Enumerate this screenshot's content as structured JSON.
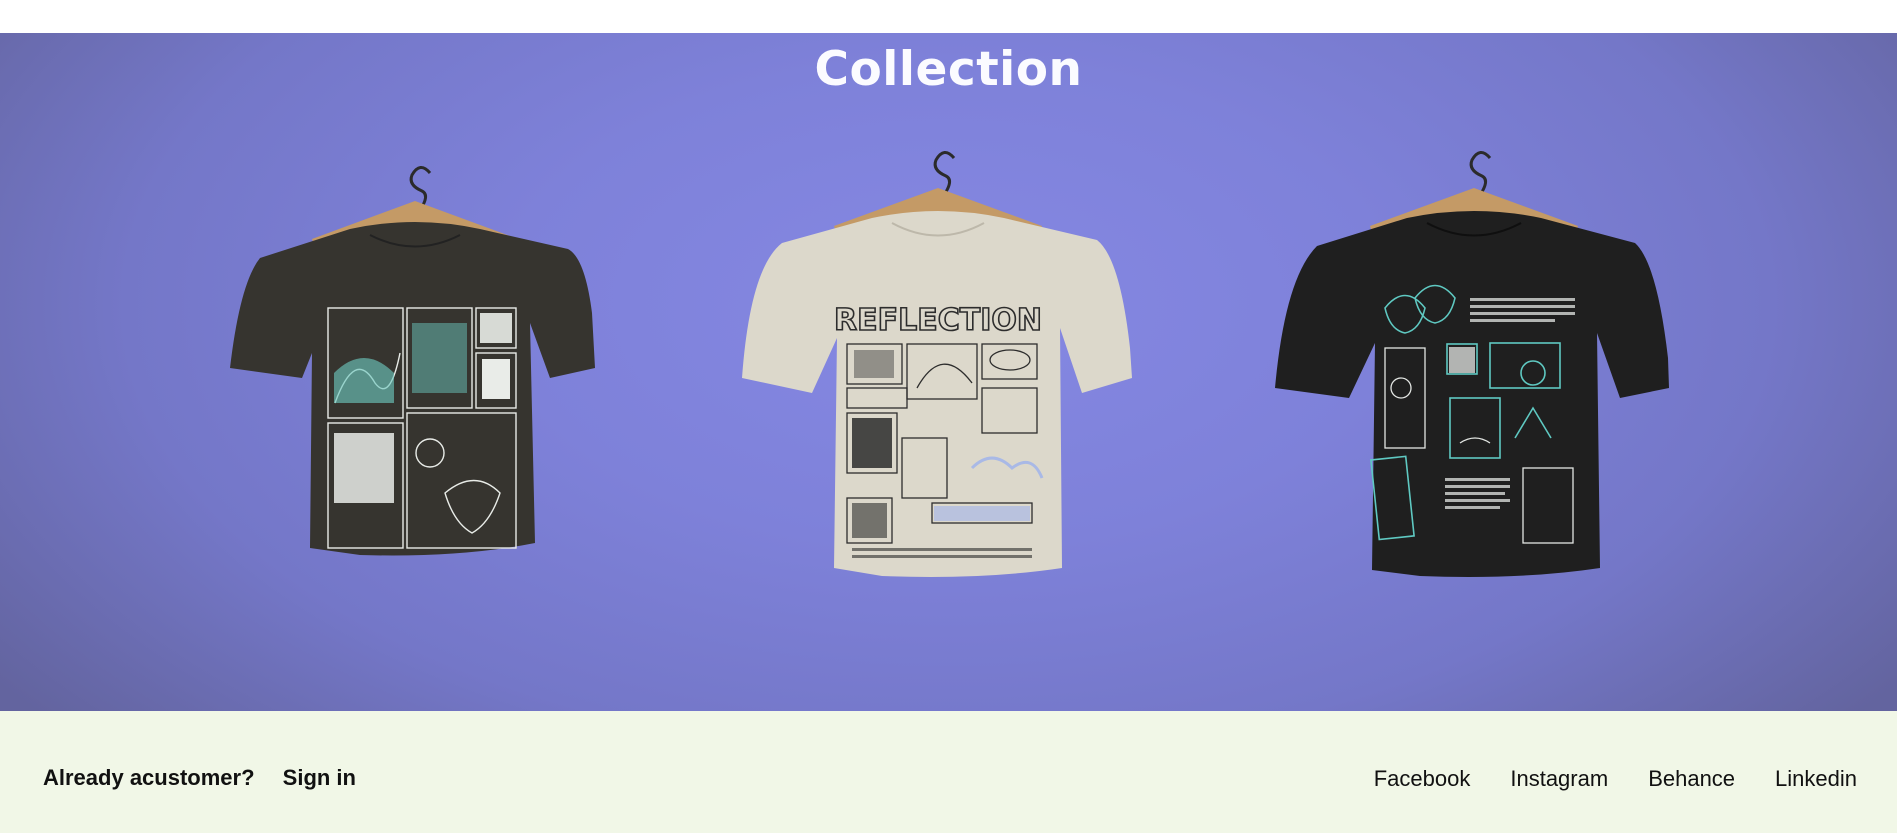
{
  "hero": {
    "title": "Collection"
  },
  "products": [
    {
      "name": "dark-graphic-tee",
      "shirt_color": "#36342f",
      "print_color": "#e9ece8",
      "accent_color": "#6cc7bd"
    },
    {
      "name": "reflection-tee",
      "shirt_color": "#dcd8cb",
      "print_color": "#2d2d2d",
      "accent_color": "#a9b9e6",
      "print_title": "REFLECTION"
    },
    {
      "name": "black-graphic-tee",
      "shirt_color": "#1f1f1f",
      "print_color": "#e3e6e3",
      "accent_color": "#5fc9c2"
    }
  ],
  "footer": {
    "customer_text": "Already acustomer?",
    "signin_label": "Sign in",
    "social": {
      "facebook": "Facebook",
      "instagram": "Instagram",
      "behance": "Behance",
      "linkedin": "Linkedin"
    }
  },
  "colors": {
    "hero_bg": "#8285de",
    "footer_bg": "#f1f7e7",
    "title": "#fbfbff"
  }
}
